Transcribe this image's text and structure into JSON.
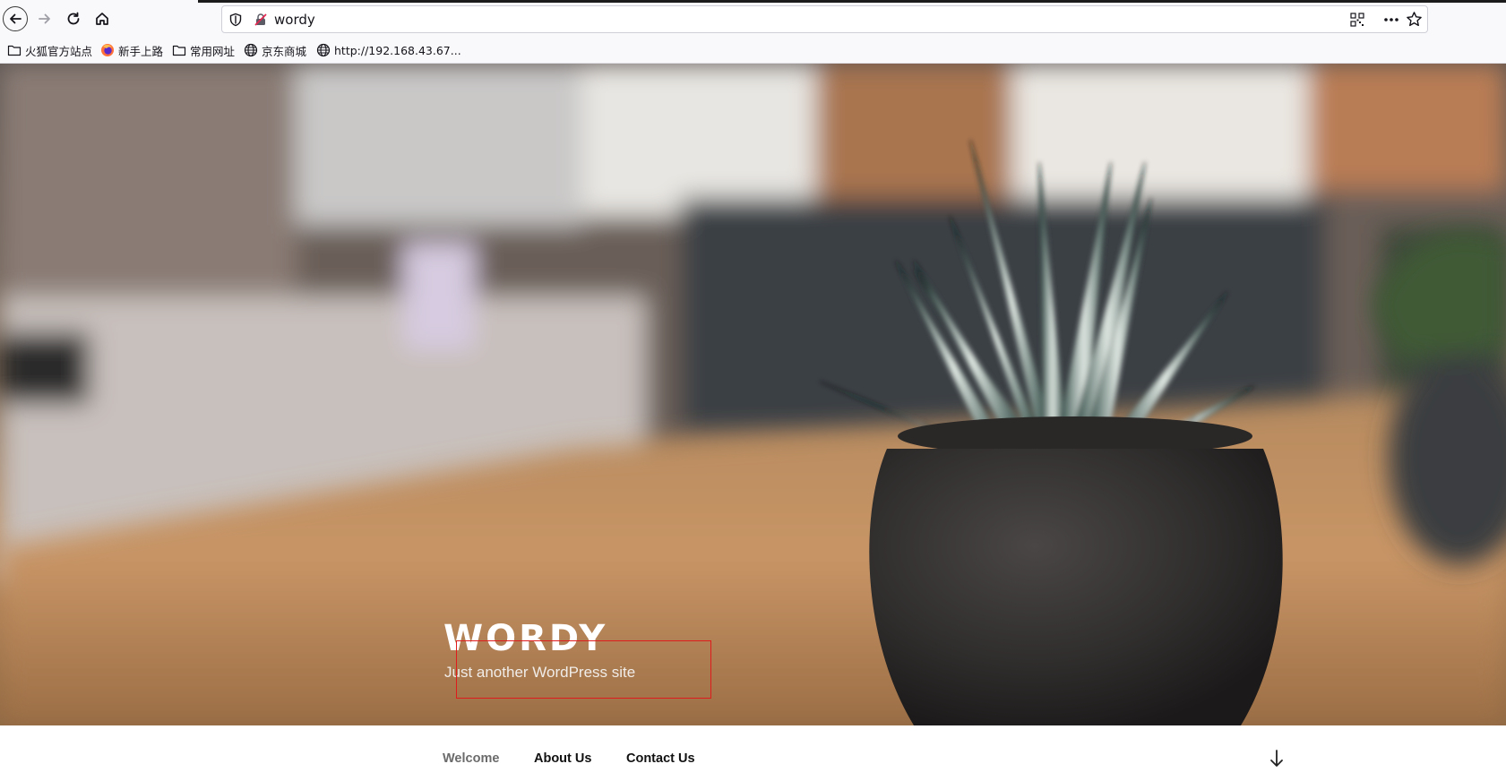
{
  "browser": {
    "url": "wordy",
    "bookmarks": [
      {
        "label": "火狐官方站点",
        "icon": "folder-icon"
      },
      {
        "label": "新手上路",
        "icon": "firefox-icon"
      },
      {
        "label": "常用网址",
        "icon": "folder-icon"
      },
      {
        "label": "京东商城",
        "icon": "globe-icon"
      },
      {
        "label": "http://192.168.43.67...",
        "icon": "globe-icon"
      }
    ]
  },
  "site": {
    "title": "WORDY",
    "description": "Just another WordPress site"
  },
  "nav": {
    "items": [
      {
        "label": "Welcome",
        "current": true
      },
      {
        "label": "About Us",
        "current": false
      },
      {
        "label": "Contact Us",
        "current": false
      }
    ]
  },
  "colors": {
    "highlight_box": "#e01b1b",
    "current_menu_item": "#6b6b6b",
    "menu_item": "#111111"
  }
}
